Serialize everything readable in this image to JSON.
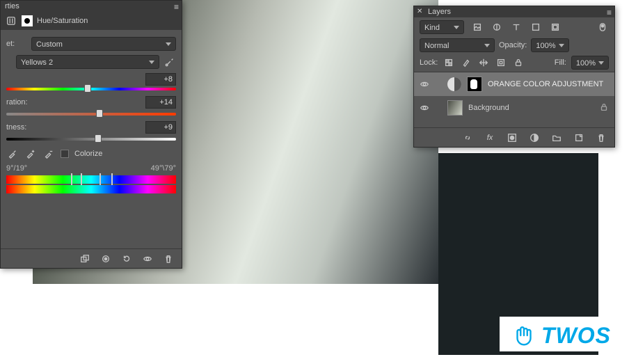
{
  "properties": {
    "tab": "rties",
    "adjustment_title": "Hue/Saturation",
    "preset_label": "et:",
    "preset_value": "Custom",
    "range_value": "Yellows 2",
    "hue_label": "",
    "hue_value": "+8",
    "sat_label": "ration:",
    "sat_value": "+14",
    "lit_label": "tness:",
    "lit_value": "+9",
    "colorize_label": "Colorize",
    "range_left": "9°/19°",
    "range_right": "49°\\79°"
  },
  "layers": {
    "tab": "Layers",
    "kind_label": "Kind",
    "blend_mode": "Normal",
    "opacity_label": "Opacity:",
    "opacity_value": "100%",
    "lock_label": "Lock:",
    "fill_label": "Fill:",
    "fill_value": "100%",
    "items": [
      {
        "name": "ORANGE COLOR ADJUSTMENT",
        "selected": true,
        "type": "adjustment"
      },
      {
        "name": "Background",
        "selected": false,
        "type": "image",
        "locked": true
      }
    ]
  },
  "watermark": "TWOS"
}
